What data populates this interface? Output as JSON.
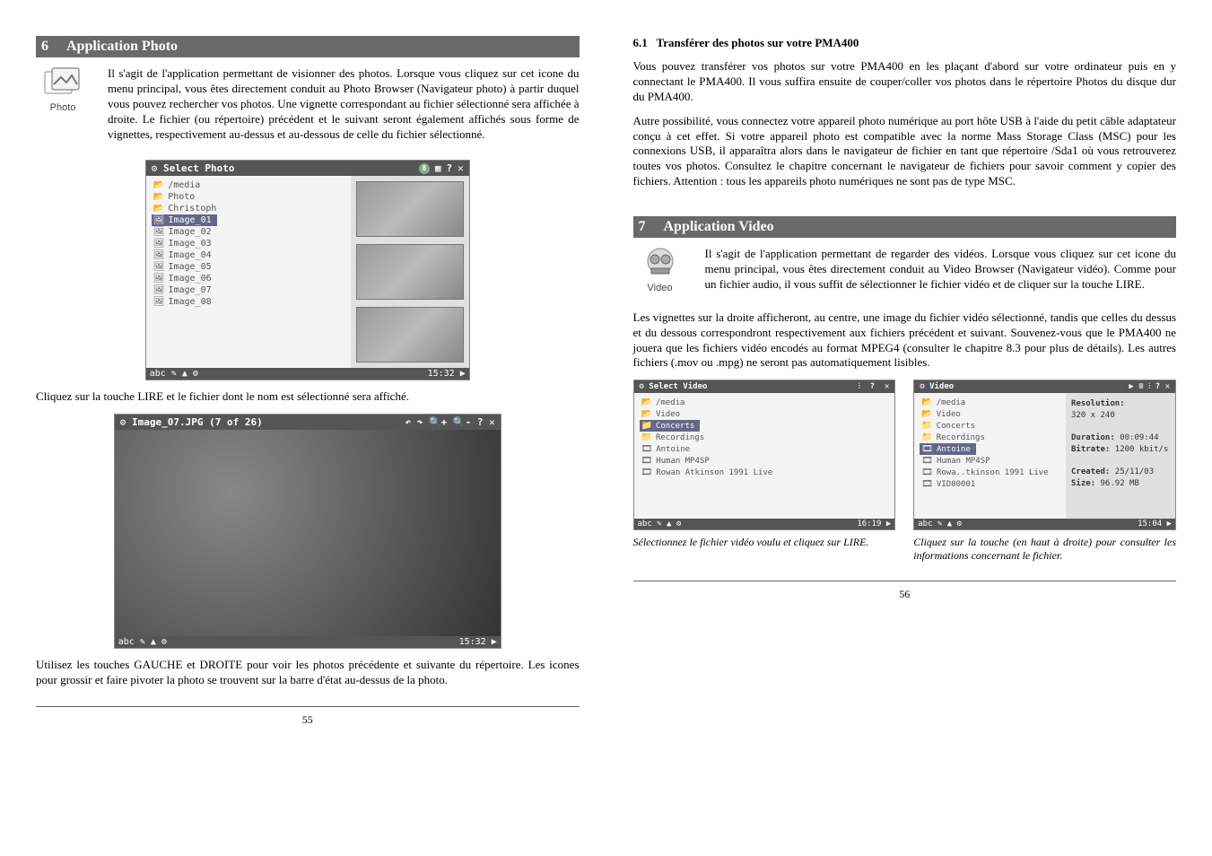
{
  "left": {
    "section_num": "6",
    "section_title": "Application Photo",
    "icon_label": "Photo",
    "intro": "Il s'agit de l'application permettant de visionner des photos. Lorsque vous cliquez sur cet icone du menu principal, vous êtes directement conduit au Photo Browser (Navigateur photo) à partir duquel vous pouvez rechercher vos photos. Une vignette correspondant au fichier sélectionné sera affichée à droite. Le fichier (ou répertoire) précédent et le suivant seront également affichés sous forme de vignettes, respectivement au-dessus et au-dessous de celle du fichier sélectionné.",
    "browser": {
      "title": "Select Photo",
      "header_badge": "8",
      "items": [
        {
          "icon": "📂",
          "label": "/media"
        },
        {
          "icon": "📂",
          "label": "Photo"
        },
        {
          "icon": "📂",
          "label": "Christoph"
        },
        {
          "icon": "🖼",
          "label": "Image_01",
          "sel": true
        },
        {
          "icon": "🖼",
          "label": "Image_02"
        },
        {
          "icon": "🖼",
          "label": "Image_03"
        },
        {
          "icon": "🖼",
          "label": "Image_04"
        },
        {
          "icon": "🖼",
          "label": "Image_05"
        },
        {
          "icon": "🖼",
          "label": "Image_06"
        },
        {
          "icon": "🖼",
          "label": "Image_07"
        },
        {
          "icon": "🖼",
          "label": "Image_08"
        }
      ],
      "footer_left": "abc ✎ ▲ ⚙",
      "footer_right": "15:32 ▶"
    },
    "mid_text": "Cliquez sur la touche LIRE et le fichier dont le nom est sélectionné sera affiché.",
    "viewer": {
      "title": "Image_07.JPG (7 of 26)",
      "header_right": "↶  ↷   🔍+  🔍-  ?  ✕",
      "footer_left": "abc ✎ ▲ ⚙",
      "footer_right": "15:32 ▶"
    },
    "bottom_text": "Utilisez les touches GAUCHE et DROITE pour voir les photos précédente et suivante du répertoire. Les icones pour grossir et faire pivoter la photo se trouvent sur la barre d'état au-dessus de la photo.",
    "page": "55"
  },
  "right": {
    "sub_num": "6.1",
    "sub_title": "Transférer des photos sur votre PMA400",
    "p1": "Vous pouvez transférer vos photos sur votre PMA400 en les plaçant d'abord sur votre ordinateur puis en y connectant le PMA400. Il vous suffira ensuite de couper/coller vos photos dans le répertoire Photos du disque dur du PMA400.",
    "p2": "Autre possibilité, vous connectez votre appareil photo numérique au port hôte USB à l'aide du petit câble adaptateur conçu à cet effet. Si votre appareil photo est compatible avec la norme Mass Storage Class (MSC) pour les connexions USB, il apparaîtra alors dans le navigateur de fichier en tant que répertoire /Sda1 où vous retrouverez toutes vos photos. Consultez le chapitre concernant le navigateur de fichiers pour savoir comment y copier des fichiers. Attention : tous les appareils photo numériques ne sont pas de type MSC.",
    "section_num": "7",
    "section_title": "Application Video",
    "icon_label": "Video",
    "intro": "Il s'agit de l'application permettant de regarder des vidéos. Lorsque vous cliquez sur cet icone du menu principal, vous êtes directement conduit au Video Browser (Navigateur vidéo). Comme pour un fichier audio, il vous suffit de sélectionner le fichier vidéo et de cliquer sur la touche LIRE.",
    "below": "Les vignettes sur la droite afficheront, au centre, une image du fichier vidéo sélectionné, tandis que celles du dessus et du dessous correspondront respectivement aux fichiers précédent et suivant. Souvenez-vous que le PMA400 ne jouera que les fichiers vidéo encodés au format MPEG4 (consulter le chapitre 8.3 pour plus de détails). Les autres fichiers (.mov ou .mpg) ne seront pas automatiquement lisibles.",
    "box1": {
      "title": "Select Video",
      "items": [
        {
          "icon": "📂",
          "label": "/media"
        },
        {
          "icon": "📂",
          "label": "Video"
        },
        {
          "icon": "📁",
          "label": "Concerts",
          "sel": true
        },
        {
          "icon": "📁",
          "label": "Recordings"
        },
        {
          "icon": "🎞",
          "label": "Antoine"
        },
        {
          "icon": "🎞",
          "label": "Human MP4SP"
        },
        {
          "icon": "🎞",
          "label": "Rowan Atkinson 1991 Live"
        }
      ],
      "footer_left": "abc ✎ ▲ ⚙",
      "footer_right": "16:19 ▶"
    },
    "box2": {
      "title": "Video",
      "header_right": "▶  ≡  ⫶  ?  ✕",
      "items": [
        {
          "icon": "📂",
          "label": "/media"
        },
        {
          "icon": "📂",
          "label": "Video"
        },
        {
          "icon": "📁",
          "label": "Concerts"
        },
        {
          "icon": "📁",
          "label": "Recordings"
        },
        {
          "icon": "🎞",
          "label": "Antoine",
          "sel": true
        },
        {
          "icon": "🎞",
          "label": "Human MP4SP"
        },
        {
          "icon": "🎞",
          "label": "Rowa..tkinson 1991 Live"
        },
        {
          "icon": "🎞",
          "label": "VID00001"
        }
      ],
      "info": {
        "resolution_label": "Resolution:",
        "resolution": "320 x 240",
        "duration_label": "Duration:",
        "duration": "00:09:44",
        "bitrate_label": "Bitrate:",
        "bitrate": "1200 kbit/s",
        "created_label": "Created:",
        "created": "25/11/03",
        "size_label": "Size:",
        "size": "96.92 MB"
      },
      "footer_left": "abc ✎ ▲ ⚙",
      "footer_right": "15:04 ▶"
    },
    "caption1": "Sélectionnez le fichier vidéo voulu et cliquez sur LIRE.",
    "caption2": "Cliquez sur la touche (en haut à droite) pour consulter les informations concernant le fichier.",
    "page": "56"
  }
}
